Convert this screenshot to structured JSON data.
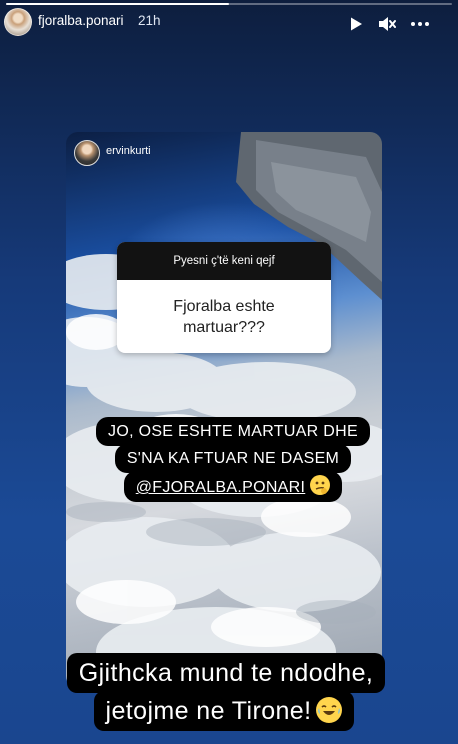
{
  "story": {
    "progress": 0.5,
    "username": "fjoralba.ponari",
    "time_ago": "21h",
    "icons": {
      "play": "play-icon",
      "mute": "mute-icon",
      "more": "more-icon"
    }
  },
  "shared_post": {
    "username": "ervinkurti",
    "question_prompt": "Pyesni ç'të keni qejf",
    "question_text": "Fjoralba eshte martuar???",
    "answer_lines": [
      "JO, OSE ESHTE MARTUAR DHE",
      "S'NA KA FTUAR NE DASEM"
    ],
    "answer_mention": "@FJORALBA.PONARI",
    "answer_emoji": "thinking-face"
  },
  "caption": {
    "line1": "Gjithcka mund te ndodhe,",
    "line2": "jetojme ne Tirone!",
    "emoji": "tears-of-joy-face"
  },
  "colors": {
    "bg_top": "#0d1e3e",
    "bg_bottom": "#1a468f",
    "accent_text": "#ffffff"
  }
}
